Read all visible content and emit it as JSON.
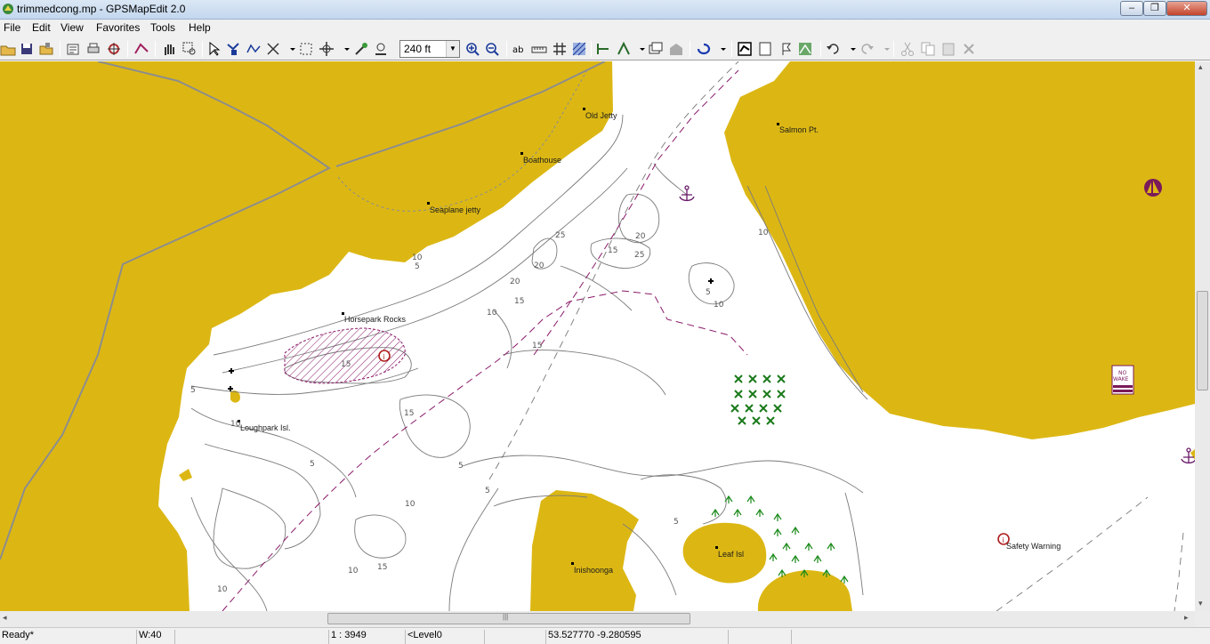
{
  "window": {
    "title": "trimmedcong.mp - GPSMapEdit 2.0",
    "minimize_glyph": "‒",
    "maximize_glyph": "❐",
    "close_glyph": "✕"
  },
  "menu": [
    "File",
    "Edit",
    "View",
    "Favorites",
    "Tools",
    "Help"
  ],
  "toolbar": {
    "zoom_value": "240 ft",
    "dropdown_glyph": "▼"
  },
  "map": {
    "place_labels": {
      "old_jetty": "Old Jetty",
      "salmon_pt": "Salmon Pt.",
      "boathouse": "Boathouse",
      "seaplane_jetty": "Seaplane jetty",
      "horsepark_rocks": "Horsepark Rocks",
      "loughpark_isl": "Loughpark Isl.",
      "inishoonga": "Inishoonga",
      "leaf_isl": "Leaf Isl",
      "safety_warning": "Safety Warning"
    },
    "depth_labels": [
      "25",
      "20",
      "15",
      "20",
      "25",
      "20",
      "15",
      "10",
      "5",
      "10",
      "15",
      "5",
      "10",
      "15",
      "5",
      "5",
      "10",
      "15",
      "10",
      "5",
      "10",
      "15",
      "10",
      "5",
      "10",
      "5"
    ],
    "no_wake_text": "NO WAKE",
    "colors": {
      "land": "#dcb714",
      "water": "#ffffff",
      "depth_contour": "#7d7d7d",
      "route": "#8a1a6a",
      "weed": "#1a8a1a",
      "hazard": "#b01c1c"
    }
  },
  "status": {
    "state": "Ready*",
    "width": "W:40",
    "scale": "1 : 3949",
    "level": "<Level0",
    "coords": "53.527770 -9.280595"
  },
  "scroll": {
    "h_left": "◂",
    "h_right": "▸",
    "v_up": "▴",
    "v_down": "▾",
    "grip": "|||"
  }
}
